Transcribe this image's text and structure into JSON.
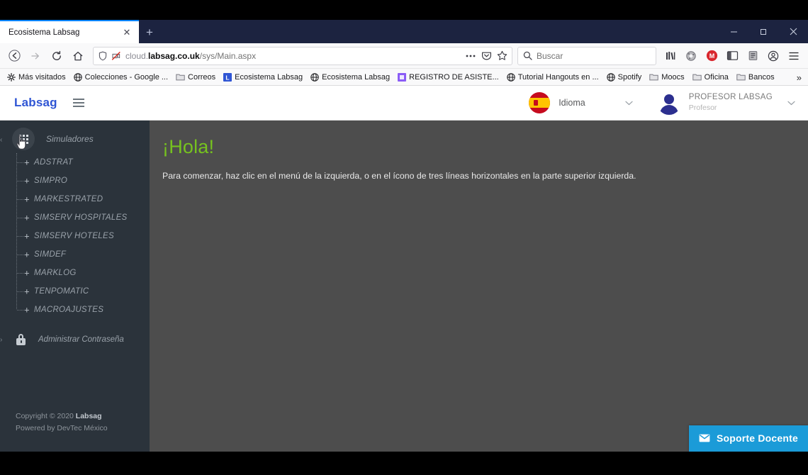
{
  "browser": {
    "tab": {
      "title": "Ecosistema Labsag",
      "close_label": "✕"
    },
    "new_tab_label": "+",
    "window_controls": {
      "minimize": "−",
      "restore": "❐",
      "close": "✕"
    },
    "nav": {
      "back": "back-arrow",
      "forward": "forward-arrow",
      "reload": "reload",
      "home": "home"
    },
    "url": {
      "prefix": "cloud.",
      "domain": "labsag.co.uk",
      "path": "/sys/Main.aspx"
    },
    "search": {
      "placeholder": "Buscar"
    },
    "bookmarks": [
      {
        "label": "Más visitados",
        "icon": "gear-icon"
      },
      {
        "label": "Colecciones - Google ...",
        "icon": "globe-icon"
      },
      {
        "label": "Correos",
        "icon": "folder-icon"
      },
      {
        "label": "Ecosistema Labsag",
        "icon": "letter-l-icon"
      },
      {
        "label": "Ecosistema Labsag",
        "icon": "globe-icon"
      },
      {
        "label": "REGISTRO DE ASISTE...",
        "icon": "purple-square-icon"
      },
      {
        "label": "Tutorial Hangouts en ...",
        "icon": "globe-icon"
      },
      {
        "label": "Spotify",
        "icon": "globe-icon"
      },
      {
        "label": "Moocs",
        "icon": "folder-icon"
      },
      {
        "label": "Oficina",
        "icon": "folder-icon"
      },
      {
        "label": "Bancos",
        "icon": "folder-icon"
      }
    ],
    "bookmarks_overflow": "»"
  },
  "app": {
    "brand": "Labsag",
    "menu_icon": "hamburger-icon",
    "language": {
      "label": "Idioma",
      "flag": "spain-flag-icon",
      "chevron": "⌄"
    },
    "user": {
      "name": "PROFESOR LABSAG",
      "role": "Profesor",
      "chevron": "⌄"
    },
    "sidebar": {
      "section": {
        "label": "Simuladores",
        "icon": "grid-apps-icon",
        "collapse": "‹"
      },
      "items": [
        {
          "label": "ADSTRAT",
          "expand": "+"
        },
        {
          "label": "SIMPRO",
          "expand": "+"
        },
        {
          "label": "MARKESTRATED",
          "expand": "+"
        },
        {
          "label": "SIMSERV HOSPITALES",
          "expand": "+"
        },
        {
          "label": "SIMSERV HOTELES",
          "expand": "+"
        },
        {
          "label": "SIMDEF",
          "expand": "+"
        },
        {
          "label": "MARKLOG",
          "expand": "+"
        },
        {
          "label": "TENPOMATIC",
          "expand": "+"
        },
        {
          "label": "MACROAJUSTES",
          "expand": "+"
        }
      ],
      "password_item": {
        "label": "Administrar Contraseña",
        "icon": "lock-icon",
        "arrow": "›"
      },
      "footer": {
        "copyright_prefix": "Copyright © 2020 ",
        "copyright_brand": "Labsag",
        "powered_by": "Powered by DevTec México"
      }
    },
    "main": {
      "heading": "¡Hola!",
      "lead": "Para comenzar, haz clic en el menú de la izquierda, o en el ícono de tres líneas horizontales en la parte superior izquierda."
    },
    "support_button": {
      "label": "Soporte Docente",
      "icon": "envelope-icon"
    }
  },
  "colors": {
    "accent_green": "#76c21f",
    "brand_blue": "#2f55d4",
    "support_blue": "#1b9bd8",
    "sidebar_bg": "#2b333b",
    "main_bg": "#4d4d4d",
    "titlebar_bg": "#1c2340"
  }
}
